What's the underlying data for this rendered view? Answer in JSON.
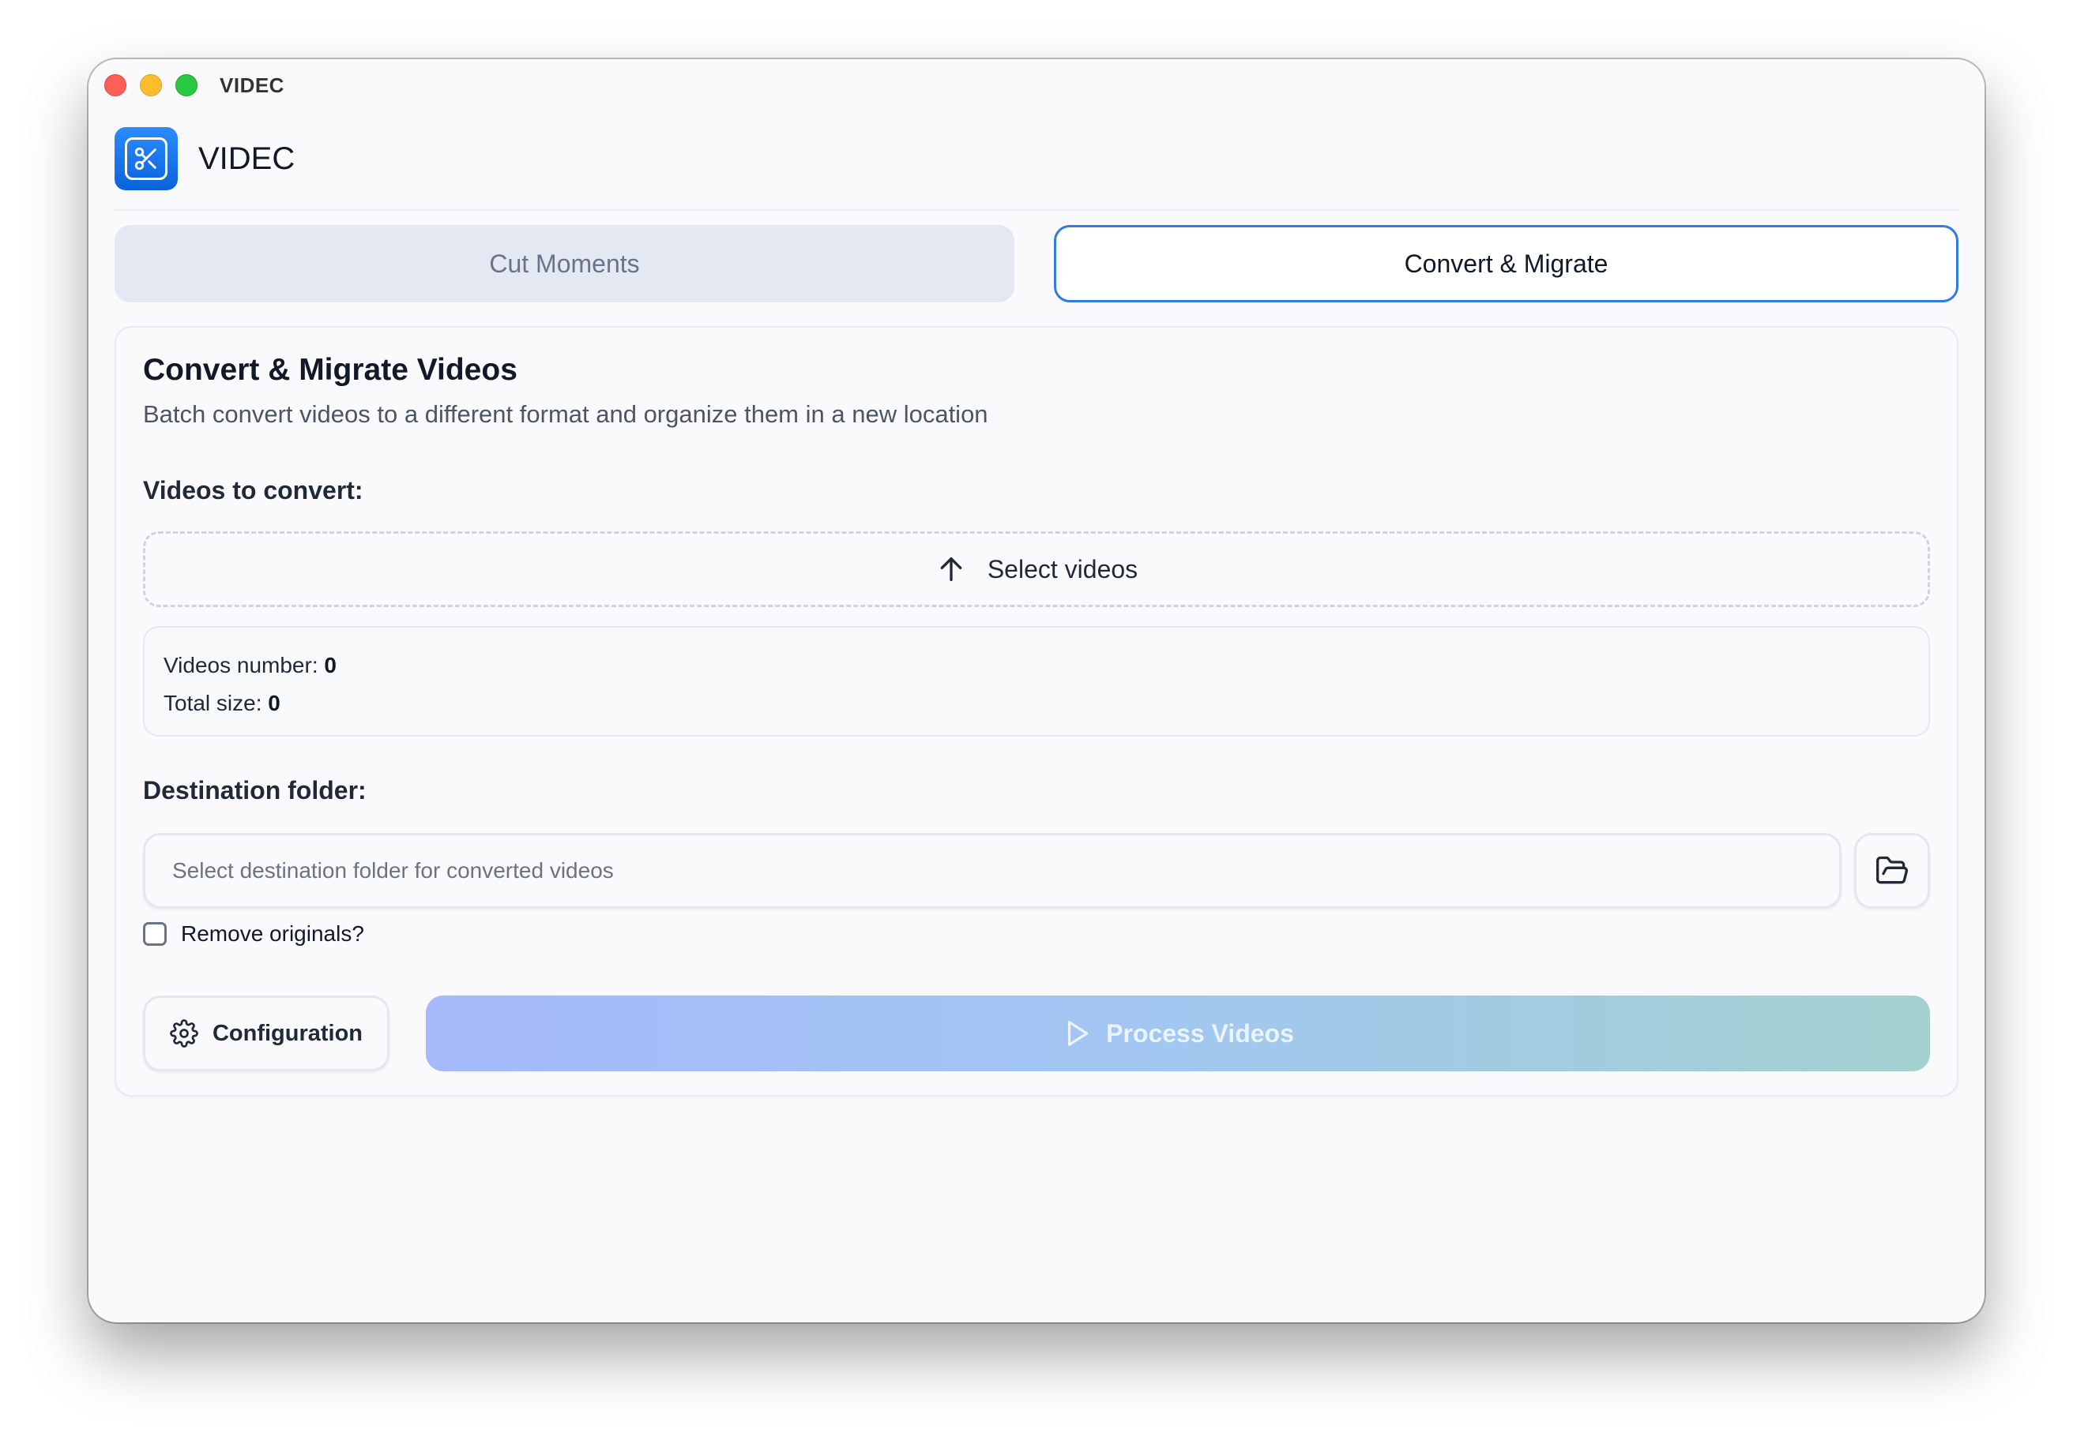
{
  "window": {
    "title": "VIDEC"
  },
  "header": {
    "app_name": "VIDEC",
    "logo_icon": "scissors-icon"
  },
  "tabs": [
    {
      "label": "Cut Moments",
      "active": false
    },
    {
      "label": "Convert & Migrate",
      "active": true
    }
  ],
  "card": {
    "title": "Convert & Migrate Videos",
    "subtitle": "Batch convert videos to a different format and organize them in a new location",
    "videos_label": "Videos to convert:",
    "select_videos_label": "Select videos",
    "stats": {
      "videos_number_label": "Videos number:",
      "videos_number_value": "0",
      "total_size_label": "Total size:",
      "total_size_value": "0"
    },
    "destination_label": "Destination folder:",
    "destination_placeholder": "Select destination folder for converted videos",
    "remove_originals_label": "Remove originals?",
    "remove_originals_checked": false,
    "config_label": "Configuration",
    "process_label": "Process Videos"
  },
  "colors": {
    "accent": "#2f7de1",
    "logo_blue": "#0a63d8",
    "process_gradient_start": "#a5b9fb",
    "process_gradient_end": "#a3d1cf"
  }
}
